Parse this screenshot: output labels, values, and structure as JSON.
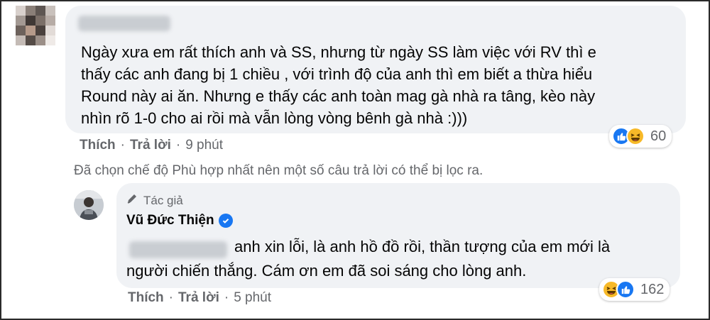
{
  "comment": {
    "text_lines": [
      "Ngày xưa em rất thích anh và SS, nhưng từ ngày SS làm việc với RV thì e",
      "thấy các anh đang bị 1 chiều , với trình độ của anh thì em biết a thừa hiểu",
      "Round này ai ăn. Nhưng e thấy các anh toàn mag gà nhà ra tâng, kèo này",
      "nhìn rõ 1-0 cho ai rồi mà vẫn lòng vòng bênh gà nhà :)))"
    ],
    "reactions": {
      "icons": [
        "like-icon",
        "haha-icon"
      ],
      "count": "60"
    },
    "actions": {
      "like": "Thích",
      "reply": "Trả lời",
      "time": "9 phút"
    }
  },
  "filter_note": "Đã chọn chế độ Phù hợp nhất nên một số câu trả lời có thể bị lọc ra.",
  "reply": {
    "author_tag": "Tác giả",
    "author_name": "Vũ Đức Thiện",
    "text_line1": "anh xin lỗi, là anh hồ đồ rồi, thần tượng của em mới là",
    "text_line2": "người chiến thắng. Cám ơn em đã soi sáng cho lòng anh.",
    "reactions": {
      "icons": [
        "haha-icon",
        "like-icon"
      ],
      "count": "162"
    },
    "actions": {
      "like": "Thích",
      "reply": "Trả lời",
      "time": "5 phút"
    }
  },
  "colors": {
    "bubble": "#f0f2f5",
    "secondary_text": "#65676b",
    "like_blue": "#1877f2",
    "haha_yellow": "#f7b928"
  }
}
